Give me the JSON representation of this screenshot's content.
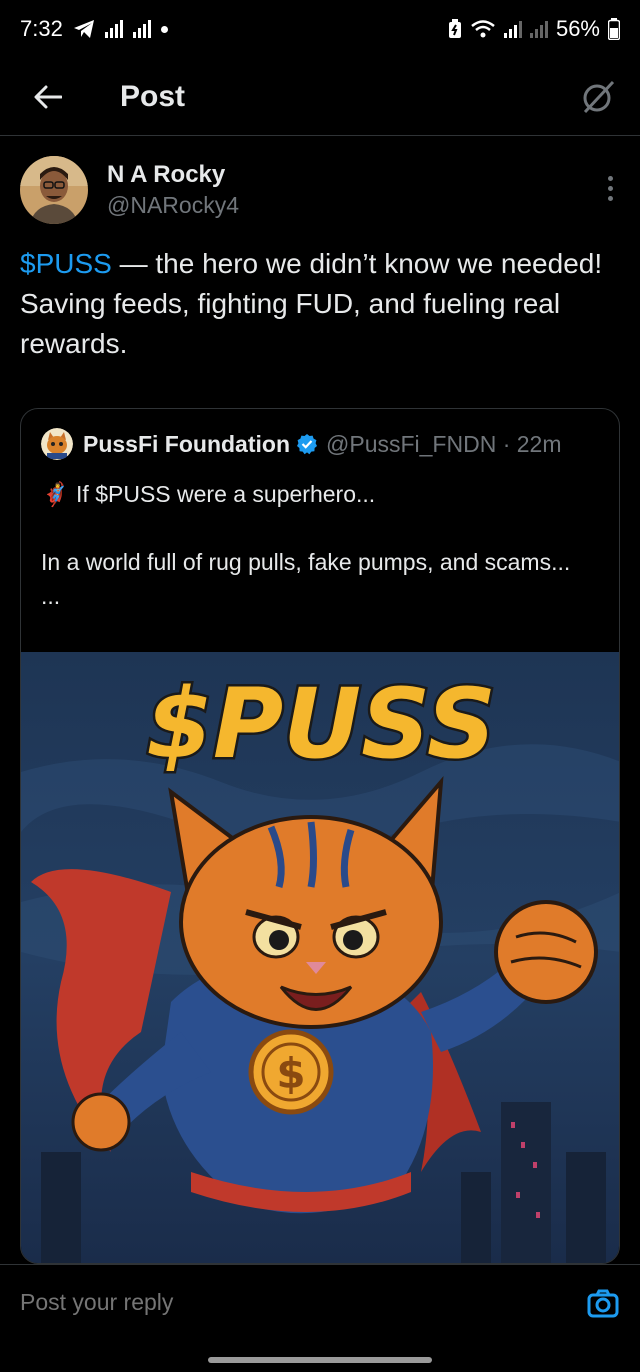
{
  "status_bar": {
    "time": "7:32",
    "battery": "56%",
    "icons": [
      "telegram-icon",
      "signal-icon",
      "signal-icon",
      "notification-dot-icon",
      "battery-saver-icon",
      "wifi-icon",
      "cell-signal-icon",
      "battery-icon"
    ]
  },
  "header": {
    "title": "Post",
    "back_icon": "arrow-left-icon",
    "grok_icon": "grok-icon"
  },
  "post": {
    "author_name": "N A Rocky",
    "author_handle": "@NARocky4",
    "cashtag": "$PUSS",
    "text_rest": " — the hero we didn’t know we needed!",
    "text_line2": "Saving feeds, fighting FUD, and fueling real rewards."
  },
  "quote": {
    "name": "PussFi Foundation",
    "handle_time": "@PussFi_FNDN · 22m",
    "line1": "🦸‍♂️ If $PUSS were a superhero...",
    "line2": "",
    "line3": "In a world full of rug pulls, fake pumps, and scams...",
    "line4": "...",
    "image_title": "$PUSS",
    "coin_symbol": "$"
  },
  "reply": {
    "placeholder": "Post your reply",
    "camera_icon": "camera-icon"
  },
  "colors": {
    "accent": "#1d9bf0",
    "text": "#e7e9ea",
    "muted": "#71767b",
    "border": "#2f3336"
  }
}
